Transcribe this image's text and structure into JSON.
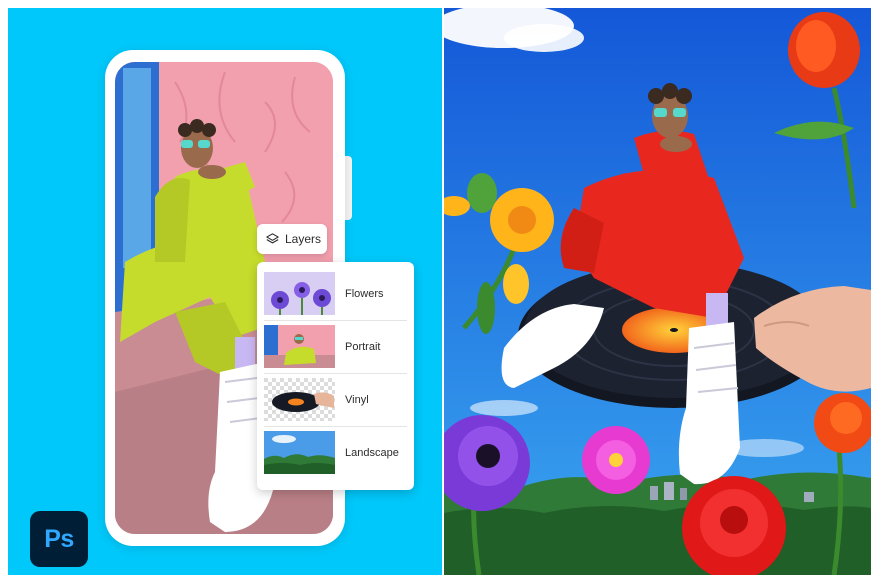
{
  "layers_chip": {
    "label": "Layers",
    "icon": "layers-icon"
  },
  "layers_panel": {
    "items": [
      {
        "label": "Flowers",
        "thumb": "flowers-thumbnail"
      },
      {
        "label": "Portrait",
        "thumb": "portrait-thumbnail"
      },
      {
        "label": "Vinyl",
        "thumb": "vinyl-thumbnail"
      },
      {
        "label": "Landscape",
        "thumb": "landscape-thumbnail"
      }
    ]
  },
  "app_logo": {
    "text": "Ps"
  },
  "colors": {
    "backdrop": "#00c8fa",
    "phone_wall": "#f3a0ae",
    "outfit_lime": "#c6dc2c",
    "outfit_red": "#e8281e",
    "sky": "#1a78e6",
    "ps_logo_bg": "#001e36",
    "ps_logo_text": "#31a8ff"
  }
}
